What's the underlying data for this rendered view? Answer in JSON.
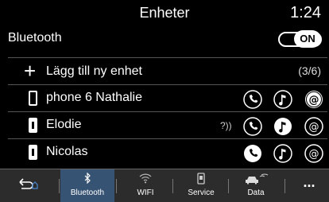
{
  "header": {
    "title": "Enheter",
    "clock": "1:24"
  },
  "bluetooth": {
    "label": "Bluetooth",
    "toggle": "ON"
  },
  "add_device": {
    "label": "Lägg till ny enhet",
    "count": "(3/6)"
  },
  "devices": [
    {
      "name": "phone 6 Nathalie",
      "phone_icon": "smartphone-outline-icon",
      "phone_state": "inactive",
      "music_state": "inactive",
      "internet_state": "active"
    },
    {
      "name": "Elodie",
      "phone_icon": "smartphone-icon",
      "phone_state": "inactive",
      "music_state": "active",
      "internet_state": "inactive"
    },
    {
      "name": "Nicolas",
      "phone_icon": "smartphone-icon",
      "phone_state": "active",
      "music_state": "inactive",
      "internet_state": "inactive"
    }
  ],
  "bottom_tabs": [
    {
      "label": "",
      "icon": "back-home-icon"
    },
    {
      "label": "Bluetooth",
      "icon": "bluetooth-icon",
      "selected": true
    },
    {
      "label": "WIFI",
      "icon": "wifi-icon"
    },
    {
      "label": "Service",
      "icon": "service-icon"
    },
    {
      "label": "Data",
      "icon": "car-data-icon"
    },
    {
      "label": "...",
      "icon": "more-icon"
    }
  ],
  "colors": {
    "background": "#000000",
    "bottom_bar": "#2c2c2c",
    "selected_tab": "#365373",
    "text": "#ffffff"
  }
}
